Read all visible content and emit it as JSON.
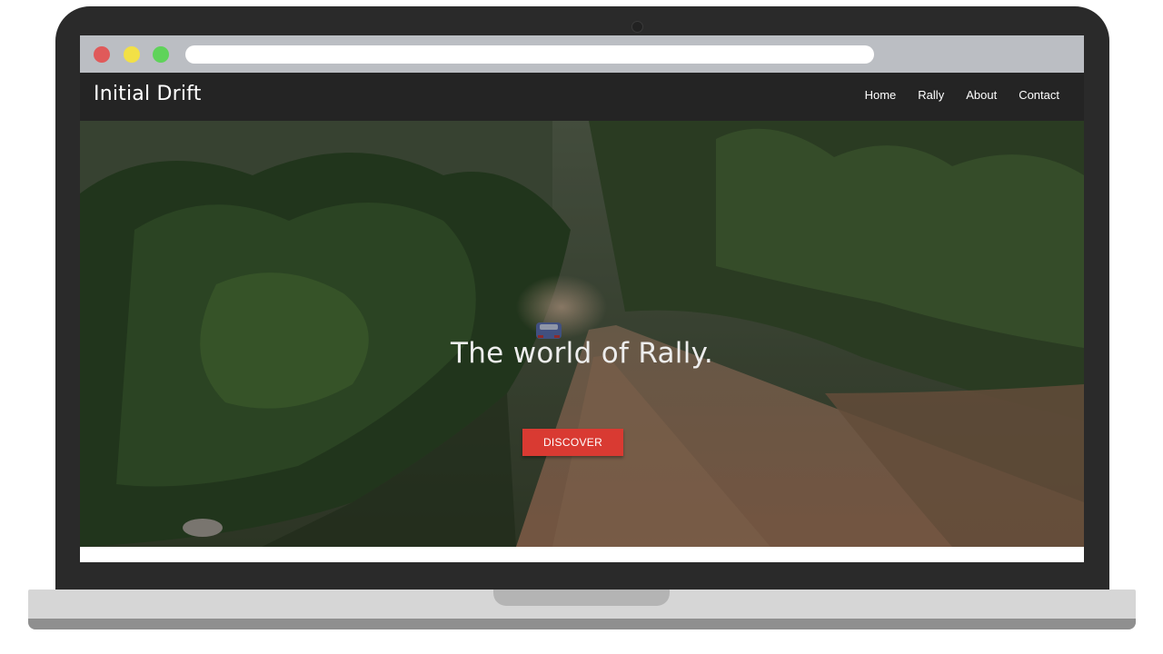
{
  "browser": {
    "url": "",
    "controls": [
      {
        "name": "close",
        "color": "#e05a5a"
      },
      {
        "name": "minimize",
        "color": "#f2e046"
      },
      {
        "name": "maximize",
        "color": "#5fd35a"
      }
    ]
  },
  "site": {
    "brand": "Initial Drift",
    "nav": [
      "Home",
      "Rally",
      "About",
      "Contact"
    ]
  },
  "hero": {
    "title": "The world of Rally.",
    "cta_label": "DISCOVER"
  },
  "colors": {
    "laptop_frame": "#2a2a2a",
    "browser_chrome": "#bbbec3",
    "navbar": "#242424",
    "accent": "#d93a32"
  },
  "icons": {
    "webcam": "webcam-icon"
  }
}
